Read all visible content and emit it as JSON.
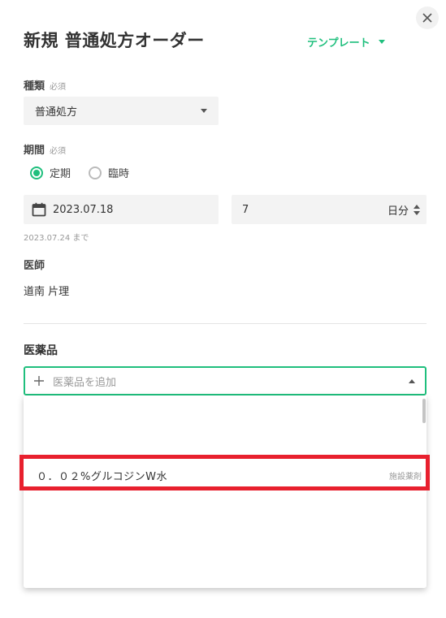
{
  "dialog": {
    "title": "新規 普通処方オーダー",
    "template_label": "テンプレート"
  },
  "type_field": {
    "label": "種類",
    "required": "必須",
    "value": "普通処方"
  },
  "period": {
    "label": "期間",
    "required": "必須",
    "options": [
      {
        "label": "定期",
        "selected": true
      },
      {
        "label": "臨時",
        "selected": false
      }
    ],
    "start_date": "2023.07.18",
    "days": "7",
    "unit": "日分",
    "end_hint": "2023.07.24 まで"
  },
  "doctor": {
    "label": "医師",
    "name": "道南 片理"
  },
  "medicine": {
    "label": "医薬品",
    "placeholder": "医薬品を追加",
    "results": [
      {
        "name": "０．０２%グルコジンW水",
        "tag": "施設薬剤"
      }
    ]
  },
  "colors": {
    "accent": "#1fbf7d",
    "highlight": "#e8202e"
  },
  "icons": [
    "close-icon",
    "chevron-down-icon",
    "calendar-icon",
    "plus-icon",
    "chevron-up-icon"
  ]
}
